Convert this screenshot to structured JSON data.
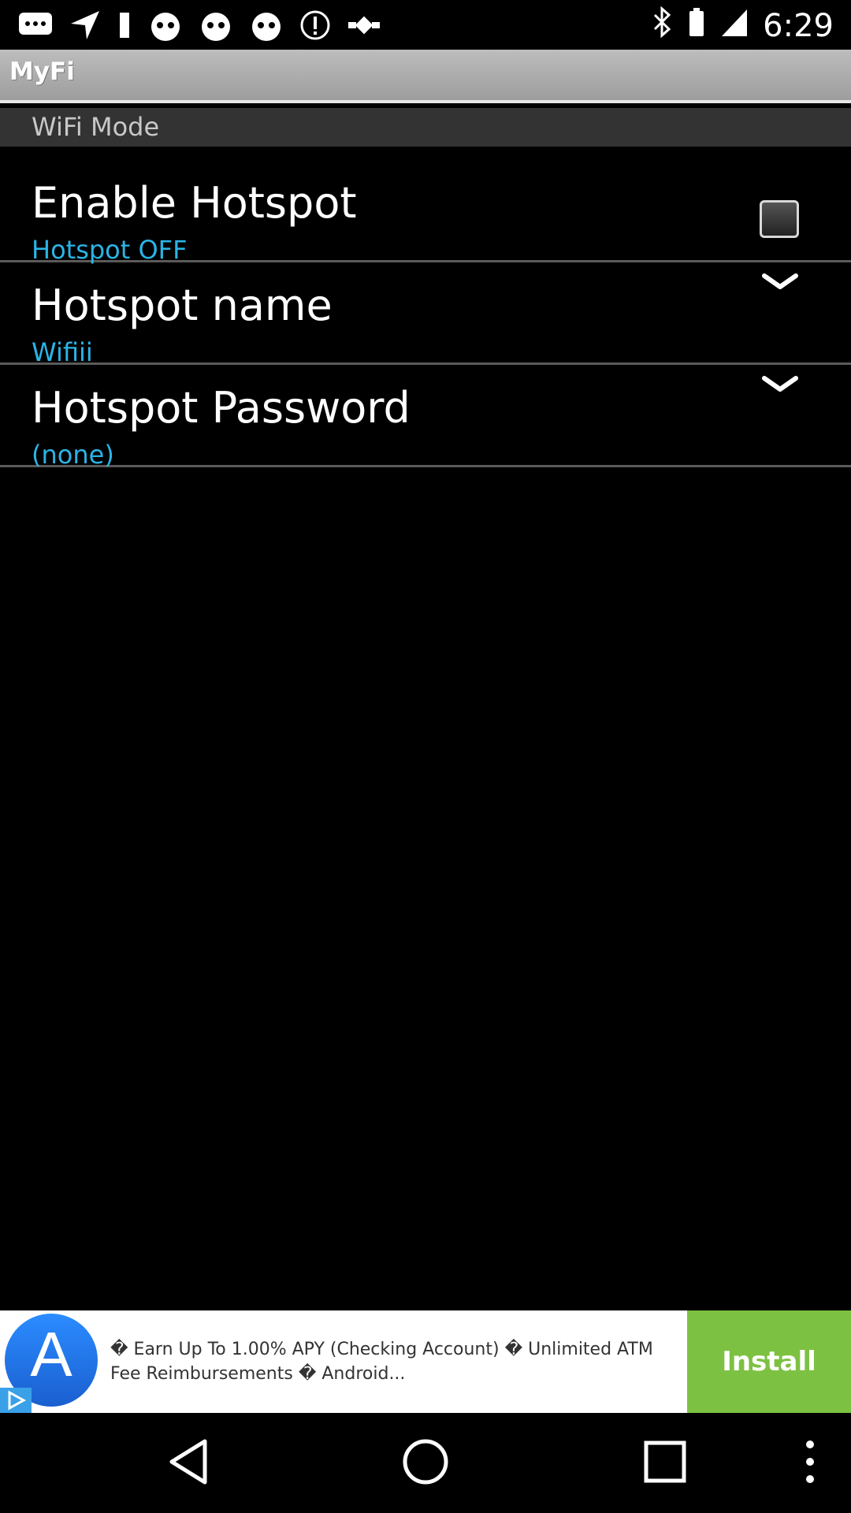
{
  "status_bar": {
    "left_icons": [
      "chat-icon",
      "navigation-icon",
      "notification-icon",
      "app-icon-1",
      "app-icon-2",
      "app-icon-3",
      "info-icon",
      "fake-gps-icon"
    ],
    "right_icons": [
      "bluetooth-icon",
      "battery-saver-icon",
      "signal-icon"
    ],
    "time": "6:29"
  },
  "app": {
    "title": "MyFi"
  },
  "section": {
    "header": "WiFi Mode"
  },
  "preferences": [
    {
      "title": "Enable Hotspot",
      "summary": "Hotspot OFF",
      "control": "checkbox",
      "checked": false
    },
    {
      "title": "Hotspot name",
      "summary": "Wifiii",
      "control": "dropdown"
    },
    {
      "title": "Hotspot Password",
      "summary": "(none)",
      "control": "dropdown"
    }
  ],
  "ad": {
    "logo_letter": "A",
    "text": "� Earn Up To 1.00% APY (Checking Account) � Unlimited ATM Fee Reimbursements � Android...",
    "install_label": "Install"
  },
  "colors": {
    "summary": "#2bb4e6",
    "install": "#7dc142",
    "section_header": "#333333"
  }
}
